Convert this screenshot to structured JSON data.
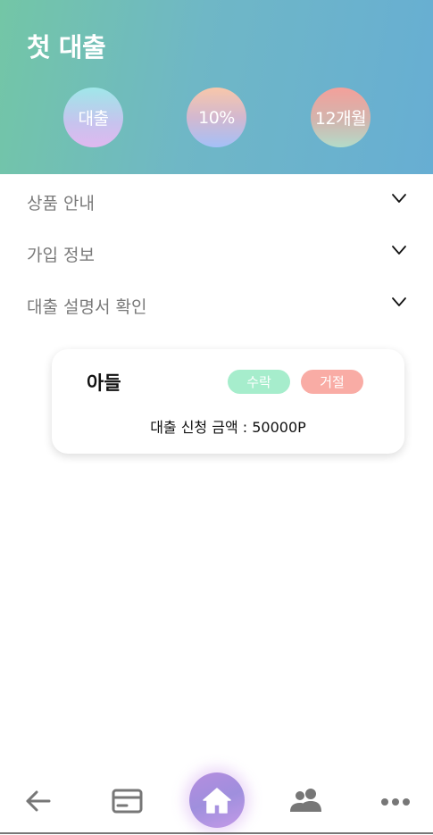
{
  "header": {
    "title": "첫 대출",
    "badges": [
      {
        "label": "대출"
      },
      {
        "label": "10%"
      },
      {
        "label": "12개월"
      }
    ]
  },
  "menu": [
    {
      "label": "상품 안내"
    },
    {
      "label": "가입 정보"
    },
    {
      "label": "대출 설명서 확인"
    }
  ],
  "request_card": {
    "name": "아들",
    "accept_label": "수락",
    "reject_label": "거절",
    "amount_text": "대출 신청 금액 : 50000P"
  },
  "bottom_nav": {
    "items": [
      {
        "icon": "back-arrow-icon"
      },
      {
        "icon": "card-icon"
      },
      {
        "icon": "home-icon"
      },
      {
        "icon": "people-icon"
      },
      {
        "icon": "more-icon"
      }
    ]
  },
  "colors": {
    "header_gradient": [
      "#73c6a6",
      "#67aed3"
    ],
    "accept": "#a6edcc",
    "reject": "#f9aca5",
    "home_button": "#a78fe0"
  }
}
